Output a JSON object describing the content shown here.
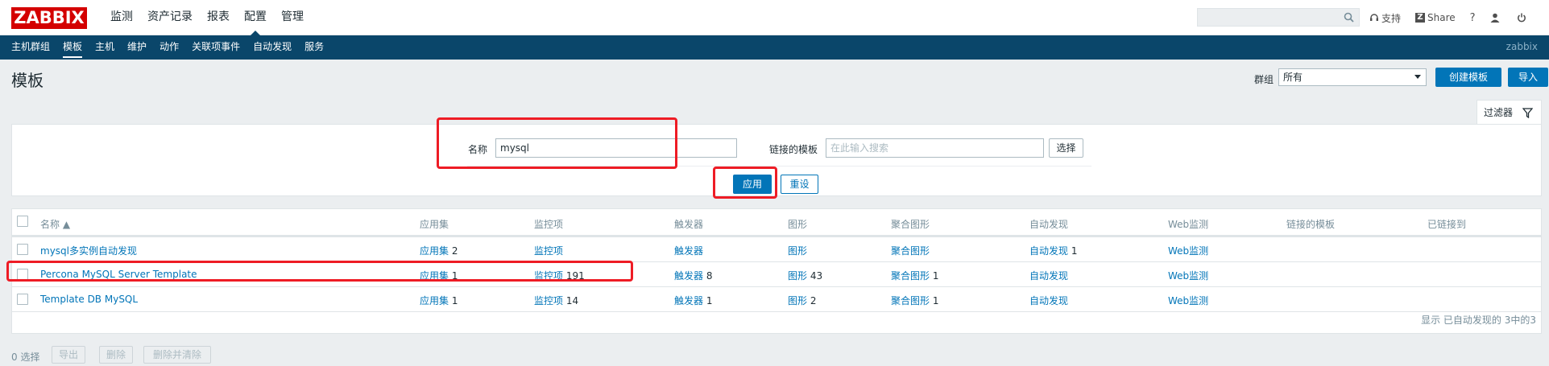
{
  "brand": {
    "logo_text": "ZABBIX",
    "logo_color": "#d40000"
  },
  "topnav": {
    "items": [
      {
        "label": "监测"
      },
      {
        "label": "资产记录"
      },
      {
        "label": "报表"
      },
      {
        "label": "配置"
      },
      {
        "label": "管理"
      }
    ],
    "active": "配置"
  },
  "topright": {
    "search_value": "",
    "support_label": "支持",
    "share_label": "Share",
    "help_label": "?"
  },
  "subnav": {
    "items": [
      {
        "label": "主机群组"
      },
      {
        "label": "模板"
      },
      {
        "label": "主机"
      },
      {
        "label": "维护"
      },
      {
        "label": "动作"
      },
      {
        "label": "关联项事件"
      },
      {
        "label": "自动发现"
      },
      {
        "label": "服务"
      }
    ],
    "active": "模板",
    "username": "zabbix"
  },
  "page": {
    "title": "模板",
    "group_label": "群组",
    "group_value": "所有",
    "create_button": "创建模板",
    "import_button": "导入"
  },
  "filter": {
    "tab_label": "过滤器",
    "name_label": "名称",
    "name_value": "mysql",
    "linked_label": "链接的模板",
    "linked_placeholder": "在此输入搜索",
    "select_button": "选择",
    "apply_button": "应用",
    "reset_button": "重设"
  },
  "table": {
    "columns": {
      "name": "名称 ▲",
      "applications": "应用集",
      "items": "监控项",
      "triggers": "触发器",
      "graphs": "图形",
      "screens": "聚合图形",
      "discovery": "自动发现",
      "web": "Web监测",
      "linked_templates": "链接的模板",
      "linked_to": "已链接到"
    },
    "rows": [
      {
        "name": "mysql多实例自动发现",
        "applications": "应用集",
        "applications_count": "2",
        "items": "监控项",
        "items_count": "",
        "triggers": "触发器",
        "triggers_count": "",
        "graphs": "图形",
        "graphs_count": "",
        "screens": "聚合图形",
        "screens_count": "",
        "discovery": "自动发现",
        "discovery_count": "1",
        "web": "Web监测"
      },
      {
        "name": "Percona MySQL Server Template",
        "applications": "应用集",
        "applications_count": "1",
        "items": "监控项",
        "items_count": "191",
        "triggers": "触发器",
        "triggers_count": "8",
        "graphs": "图形",
        "graphs_count": "43",
        "screens": "聚合图形",
        "screens_count": "1",
        "discovery": "自动发现",
        "discovery_count": "",
        "web": "Web监测"
      },
      {
        "name": "Template DB MySQL",
        "applications": "应用集",
        "applications_count": "1",
        "items": "监控项",
        "items_count": "14",
        "triggers": "触发器",
        "triggers_count": "1",
        "graphs": "图形",
        "graphs_count": "2",
        "screens": "聚合图形",
        "screens_count": "1",
        "discovery": "自动发现",
        "discovery_count": "",
        "web": "Web监测"
      }
    ],
    "footer": "显示 已自动发现的 3中的3"
  },
  "bottom": {
    "selected": "0 选择",
    "export_button": "导出",
    "delete_button": "删除",
    "delete_clear_button": "删除并清除"
  },
  "colors": {
    "accent": "#0275b8",
    "subnav_bg": "#0a466a",
    "highlight": "#ee1c25"
  }
}
